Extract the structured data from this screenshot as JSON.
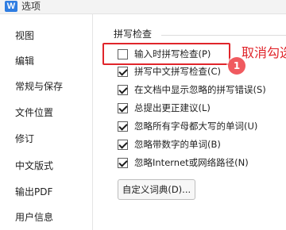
{
  "window": {
    "logo": "W",
    "title": "选项"
  },
  "sidebar": {
    "items": [
      {
        "label": "视图"
      },
      {
        "label": "编辑"
      },
      {
        "label": "常规与保存"
      },
      {
        "label": "文件位置"
      },
      {
        "label": "修订"
      },
      {
        "label": "中文版式"
      },
      {
        "label": "输出PDF"
      },
      {
        "label": "用户信息"
      }
    ]
  },
  "spellcheck": {
    "group_title": "拼写检查",
    "options": [
      {
        "label": "输入时拼写检查(P)",
        "checked": false
      },
      {
        "label": "拼写中文拼写检查(C)",
        "checked": true
      },
      {
        "label": "在文档中显示忽略的拼写错误(S)",
        "checked": true
      },
      {
        "label": "总提出更正建议(L)",
        "checked": true
      },
      {
        "label": "忽略所有字母都大写的单词(U)",
        "checked": true
      },
      {
        "label": "忽略带数字的单词(B)",
        "checked": true
      },
      {
        "label": "忽略Internet或网络路径(N)",
        "checked": true
      }
    ],
    "custom_dict_button": "自定义词典(D)..."
  },
  "annotation": {
    "step": "1",
    "text": "取消勾选",
    "color": "#e0252b"
  }
}
